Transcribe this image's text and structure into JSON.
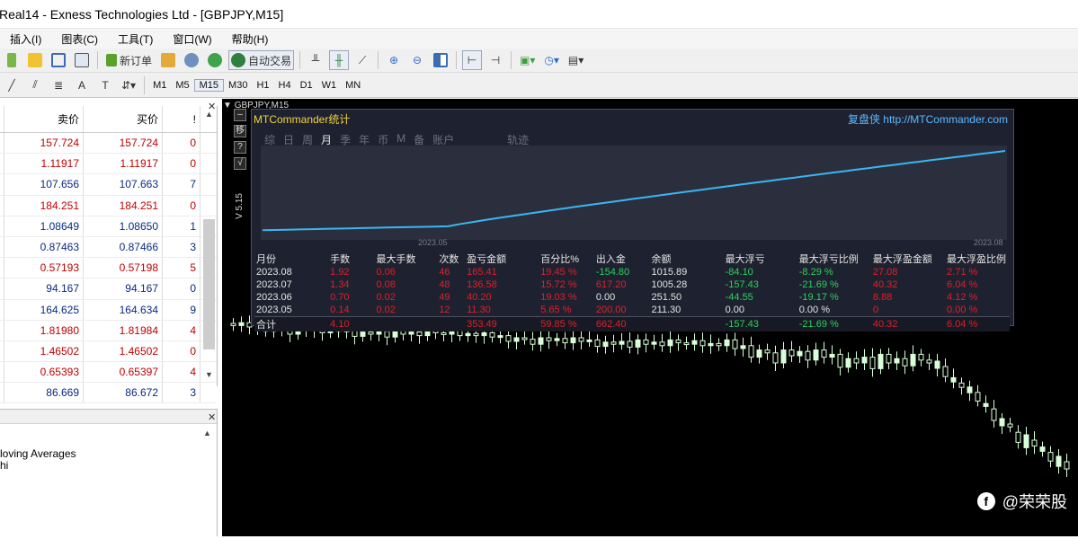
{
  "window": {
    "title": "Real14 - Exness Technologies Ltd - [GBPJPY,M15]"
  },
  "menu": [
    "插入(I)",
    "图表(C)",
    "工具(T)",
    "窗口(W)",
    "帮助(H)"
  ],
  "toolbar": {
    "new_order": "新订单",
    "auto_trade": "自动交易"
  },
  "timeframes": [
    "M1",
    "M5",
    "M15",
    "M30",
    "H1",
    "H4",
    "D1",
    "W1",
    "MN"
  ],
  "market_watch": {
    "headers": {
      "bid": "卖价",
      "ask": "买价",
      "spread": "!"
    },
    "rows": [
      {
        "bid": "157.724",
        "ask": "157.724",
        "spread": "0",
        "tone": "red"
      },
      {
        "bid": "1.11917",
        "ask": "1.11917",
        "spread": "0",
        "tone": "red"
      },
      {
        "bid": "107.656",
        "ask": "107.663",
        "spread": "7",
        "tone": "blue"
      },
      {
        "bid": "184.251",
        "ask": "184.251",
        "spread": "0",
        "tone": "red"
      },
      {
        "bid": "1.08649",
        "ask": "1.08650",
        "spread": "1",
        "tone": "blue"
      },
      {
        "bid": "0.87463",
        "ask": "0.87466",
        "spread": "3",
        "tone": "blue"
      },
      {
        "bid": "0.57193",
        "ask": "0.57198",
        "spread": "5",
        "tone": "red"
      },
      {
        "bid": "94.167",
        "ask": "94.167",
        "spread": "0",
        "tone": "blue"
      },
      {
        "bid": "164.625",
        "ask": "164.634",
        "spread": "9",
        "tone": "blue"
      },
      {
        "bid": "1.81980",
        "ask": "1.81984",
        "spread": "4",
        "tone": "red"
      },
      {
        "bid": "1.46502",
        "ask": "1.46502",
        "spread": "0",
        "tone": "red"
      },
      {
        "bid": "0.65393",
        "ask": "0.65397",
        "spread": "4",
        "tone": "red"
      },
      {
        "bid": "86.669",
        "ask": "86.672",
        "spread": "3",
        "tone": "blue"
      }
    ]
  },
  "navigator": {
    "items": [
      "loving Averages",
      "hi"
    ]
  },
  "chart": {
    "title": "GBPJPY,M15"
  },
  "mtc": {
    "title": "MTCommander统计",
    "brand": "复盘侠 http://MTCommander.com",
    "tabs": [
      "综",
      "日",
      "周",
      "月",
      "季",
      "年",
      "币",
      "M",
      "备",
      "账户",
      "轨迹"
    ],
    "active_tab": "月",
    "version": "V 5.15",
    "side_buttons": [
      "–",
      "移",
      "?",
      "√"
    ],
    "x_labels": [
      "2023.05",
      "2023.08"
    ],
    "table_headers": [
      "月份",
      "手数",
      "最大手数",
      "次数",
      "盈亏金额",
      "百分比%",
      "出入金",
      "余额",
      "最大浮亏",
      "最大浮亏比例",
      "最大浮盈金额",
      "最大浮盈比例"
    ],
    "rows": [
      [
        "2023.08",
        "1.92",
        "0.06",
        "46",
        "165.41",
        "19.45 %",
        "-154.80",
        "1015.89",
        "-84.10",
        "-8.29 %",
        "27.08",
        "2.71 %"
      ],
      [
        "2023.07",
        "1.34",
        "0.08",
        "48",
        "136.58",
        "15.72 %",
        "617.20",
        "1005.28",
        "-157.43",
        "-21.69 %",
        "40.32",
        "6.04 %"
      ],
      [
        "2023.06",
        "0.70",
        "0.02",
        "49",
        "40.20",
        "19.03 %",
        "0.00",
        "251.50",
        "-44.55",
        "-19.17 %",
        "8.88",
        "4.12 %"
      ],
      [
        "2023.05",
        "0.14",
        "0.02",
        "12",
        "11.30",
        "5.65 %",
        "200.00",
        "211.30",
        "0.00",
        "0.00 %",
        "0",
        "0.00 %"
      ]
    ],
    "total": [
      "合计",
      "4.10",
      "",
      "",
      "353.49",
      "59.85 %",
      "662.40",
      "",
      "-157.43",
      "-21.69 %",
      "40.32",
      "6.04 %"
    ],
    "equity_curve": [
      211.3,
      240,
      251.5,
      520,
      1005.28,
      1015.89
    ]
  },
  "watermark": "@荣荣股"
}
